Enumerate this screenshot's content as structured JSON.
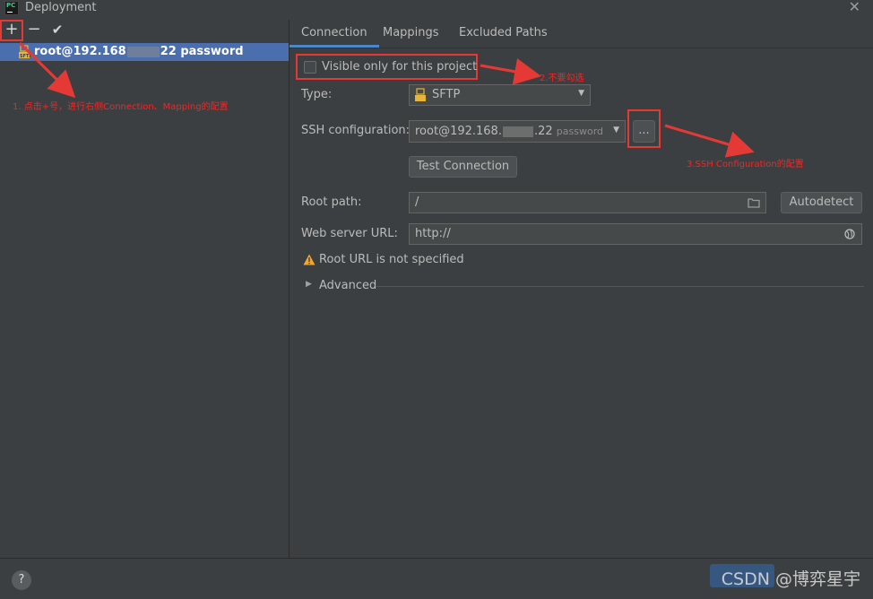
{
  "window": {
    "title": "Deployment"
  },
  "toolbar": {
    "add": "+",
    "remove": "−",
    "apply": "✔"
  },
  "server_list": {
    "items": [
      {
        "name_prefix": "root@192.168",
        "name_suffix": "22 password"
      }
    ]
  },
  "tabs": [
    "Connection",
    "Mappings",
    "Excluded Paths"
  ],
  "connection": {
    "visible_only_label": "Visible only for this project",
    "type_label": "Type:",
    "type_value": "SFTP",
    "ssh_label": "SSH configuration:",
    "ssh_value_prefix": "root@192.168.",
    "ssh_value_suffix": ".22",
    "ssh_value_hint": "password",
    "ssh_browse": "...",
    "test_connection": "Test Connection",
    "root_path_label": "Root path:",
    "root_path_value": "/",
    "autodetect": "Autodetect",
    "web_url_label": "Web server URL:",
    "web_url_value": "http://",
    "warning": "Root URL is not specified",
    "advanced": "Advanced"
  },
  "annotations": {
    "a1": "1. 点击+号，进行右侧Connection、Mapping的配置",
    "a2": "2.不要勾选",
    "a3": "3.SSH Configuration的配置"
  },
  "footer": {
    "help": "?",
    "watermark": "CSDN @博弈星宇"
  },
  "colors": {
    "accent": "#4b6eaf",
    "tab_underline": "#4a88c7",
    "annotation": "#e53935"
  }
}
